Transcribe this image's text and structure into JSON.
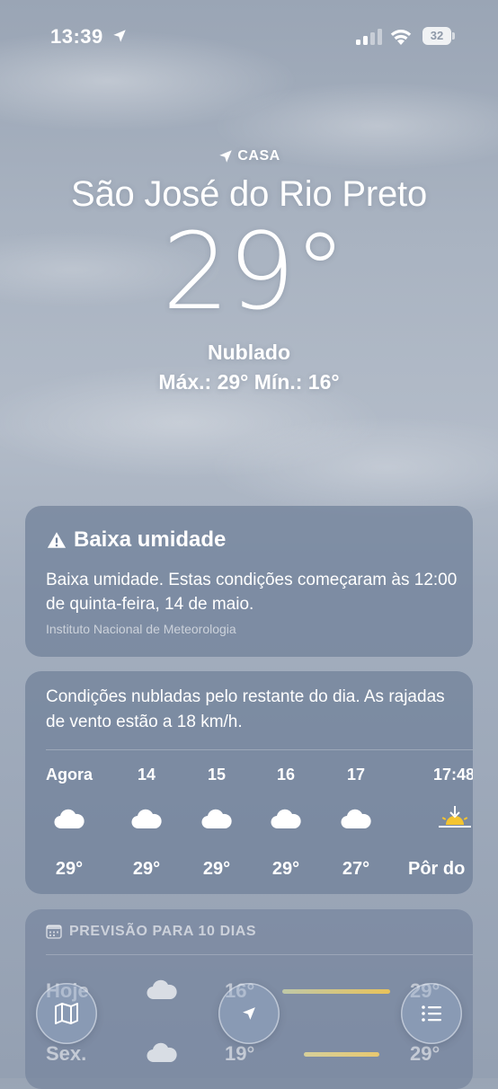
{
  "status_bar": {
    "time": "13:39",
    "battery": "32",
    "location_icon": "location-arrow-icon",
    "signal_icon": "cellular-signal-icon",
    "wifi_icon": "wifi-icon"
  },
  "header": {
    "home_label": "CASA",
    "city": "São José do Rio Preto",
    "temperature": "29°",
    "condition": "Nublado",
    "hilo": "Máx.: 29°  Mín.: 16°"
  },
  "alert": {
    "title": "Baixa umidade",
    "text": "Baixa umidade. Estas condições começaram às 12:00 de quinta-feira, 14 de maio.",
    "source": "Instituto Nacional de Meteorologia",
    "icon": "warning-icon"
  },
  "hourly": {
    "summary": "Condições nubladas pelo restante do dia. As rajadas de vento estão a 18 km/h.",
    "items": [
      {
        "label": "Agora",
        "icon": "cloud-icon",
        "temp": "29°"
      },
      {
        "label": "14",
        "icon": "cloud-icon",
        "temp": "29°"
      },
      {
        "label": "15",
        "icon": "cloud-icon",
        "temp": "29°"
      },
      {
        "label": "16",
        "icon": "cloud-icon",
        "temp": "29°"
      },
      {
        "label": "17",
        "icon": "cloud-icon",
        "temp": "27°"
      },
      {
        "label": "17:48",
        "icon": "sunset-icon",
        "temp": "Pôr do"
      }
    ]
  },
  "ten_day": {
    "heading": "PREVISÃO PARA 10 DIAS",
    "icon": "calendar-icon",
    "days": [
      {
        "day": "Hoje",
        "icon": "cloud-icon",
        "min": "16°",
        "max": "29°",
        "bar_colors": [
          "#bfc8a8",
          "#e9c35a"
        ]
      },
      {
        "day": "Sex.",
        "icon": "cloud-icon",
        "min": "19°",
        "max": "29°",
        "bar_colors": [
          "#d6cf9a",
          "#e8c870"
        ]
      }
    ]
  },
  "toolbar": {
    "map_icon": "map-icon",
    "location_icon": "location-arrow-icon",
    "list_icon": "list-icon"
  }
}
